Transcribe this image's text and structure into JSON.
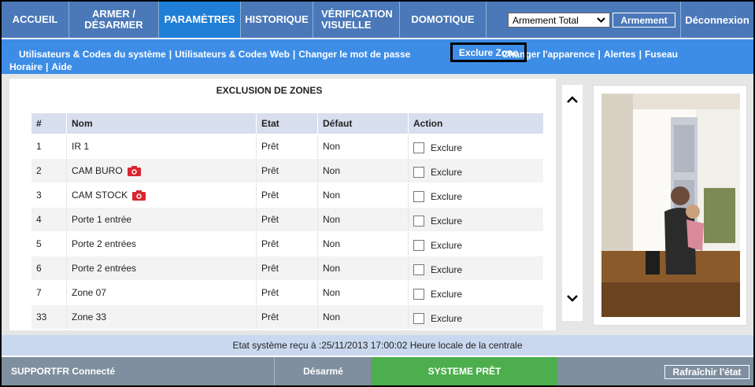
{
  "topnav": {
    "items": [
      {
        "label": "ACCUEIL"
      },
      {
        "label": "ARMER /\nDÉSARMER"
      },
      {
        "label": "PARAMÈTRES"
      },
      {
        "label": "HISTORIQUE"
      },
      {
        "label": "VÉRIFICATION\nVISUELLE"
      },
      {
        "label": "DOMOTIQUE"
      }
    ],
    "arm_select": {
      "value": "Armement Total"
    },
    "arm_button_label": "Armement",
    "logout_label": "Déconnexion"
  },
  "subnav": {
    "links": [
      "Utilisateurs & Codes du système",
      "Utilisateurs & Codes Web",
      "Changer le mot de passe"
    ],
    "active": "Exclure Zone",
    "after_links": [
      "Changer l'apparence",
      "Alertes",
      "Fuseau"
    ],
    "line2_links": [
      "Horaire",
      "Aide"
    ]
  },
  "panel": {
    "title": "EXCLUSION DE ZONES",
    "columns": [
      "#",
      "Nom",
      "Etat",
      "Défaut",
      "Action"
    ],
    "rows": [
      {
        "num": "1",
        "nom": "IR 1",
        "etat": "Prêt",
        "defaut": "Non",
        "action": "Exclure",
        "camera": false
      },
      {
        "num": "2",
        "nom": "CAM BURO",
        "etat": "Prêt",
        "defaut": "Non",
        "action": "Exclure",
        "camera": true
      },
      {
        "num": "3",
        "nom": "CAM STOCK",
        "etat": "Prêt",
        "defaut": "Non",
        "action": "Exclure",
        "camera": true
      },
      {
        "num": "4",
        "nom": "Porte 1 entrée",
        "etat": "Prêt",
        "defaut": "Non",
        "action": "Exclure",
        "camera": false
      },
      {
        "num": "5",
        "nom": "Porte 2 entrées",
        "etat": "Prêt",
        "defaut": "Non",
        "action": "Exclure",
        "camera": false
      },
      {
        "num": "6",
        "nom": "Porte 2 entrées",
        "etat": "Prêt",
        "defaut": "Non",
        "action": "Exclure",
        "camera": false
      },
      {
        "num": "7",
        "nom": "Zone 07",
        "etat": "Prêt",
        "defaut": "Non",
        "action": "Exclure",
        "camera": false
      },
      {
        "num": "33",
        "nom": "Zone 33",
        "etat": "Prêt",
        "defaut": "Non",
        "action": "Exclure",
        "camera": false
      }
    ]
  },
  "status_line": "Etat système reçu à :25/11/2013 17:00:02 Heure locale de la centrale",
  "footer": {
    "support": "SUPPORTFR Connecté",
    "arm_state": "Désarmé",
    "system_state": "SYSTEME PRÊT",
    "refresh_label": "Rafraîchir l'état"
  },
  "colors": {
    "topnav_bg": "#4a78b8",
    "topnav_active": "#1f7fd6",
    "subnav_bg": "#3d8de6",
    "footer_bg": "#7f8f9f",
    "ready_green": "#4cae4c",
    "camera_red": "#d9262f"
  },
  "icons": [
    "chevron-down-icon",
    "camera-icon",
    "scroll-up-icon",
    "scroll-down-icon"
  ]
}
